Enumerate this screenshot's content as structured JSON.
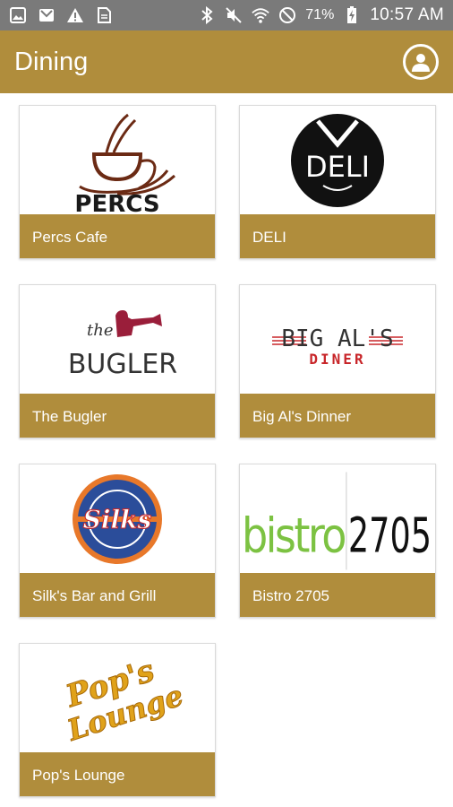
{
  "status_bar": {
    "battery_percent": "71%",
    "time": "10:57 AM"
  },
  "app_bar": {
    "title": "Dining"
  },
  "restaurants": [
    {
      "label": "Percs Cafe",
      "logo_text": "PERCS"
    },
    {
      "label": "DELI",
      "logo_text": "DELI"
    },
    {
      "label": "The Bugler",
      "logo_text_small": "the",
      "logo_text": "BUGLER"
    },
    {
      "label": "Big Al's Dinner",
      "logo_text": "BIG AL'S",
      "logo_sub": "DINER"
    },
    {
      "label": "Silk's Bar and Grill",
      "logo_text": "Silks"
    },
    {
      "label": "Bistro 2705",
      "logo_text_green": "bistro",
      "logo_text_black": "2705"
    },
    {
      "label": "Pop's Lounge",
      "logo_line1": "Pop's",
      "logo_line2": "Lounge"
    }
  ],
  "colors": {
    "accent": "#b08d3c",
    "status_bar": "#7a7a7a",
    "percs_brown": "#6b2a14",
    "bugler_maroon": "#9a1e3a",
    "bigals_red": "#c8262a",
    "bistro_green": "#7cc242",
    "pops_gold": "#e0a21a",
    "silks_blue": "#2b4d9a",
    "silks_orange": "#e8782a"
  }
}
